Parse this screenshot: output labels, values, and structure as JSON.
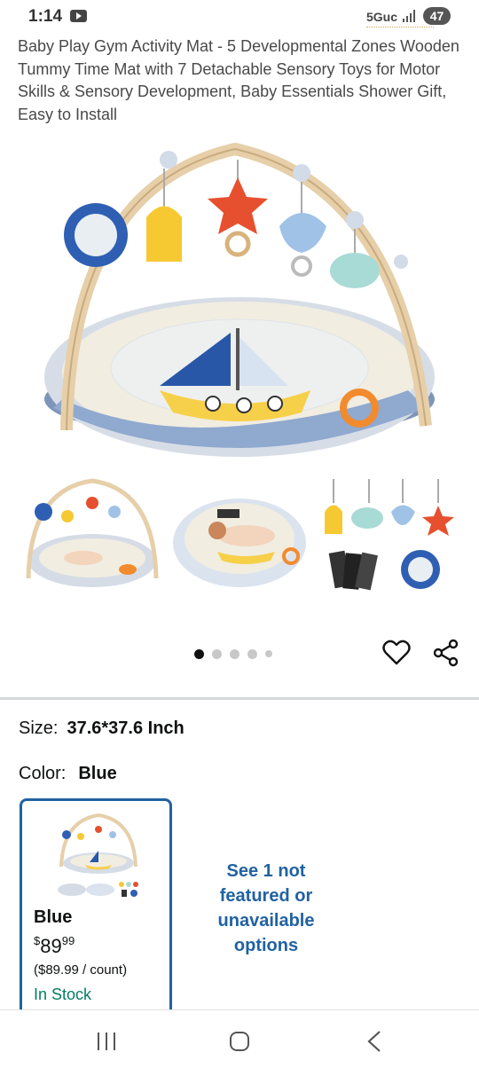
{
  "status_bar": {
    "time": "1:14",
    "network": "5Guc",
    "battery": "47"
  },
  "product": {
    "title": "Baby Play Gym Activity Mat - 5 Developmental Zones Wooden Tummy Time Mat with 7 Detachable Sensory Toys for Motor Skills & Sensory Development, Baby Essentials Shower Gift, Easy to Install"
  },
  "gallery": {
    "dot_count": 5,
    "active_index": 0
  },
  "size": {
    "label": "Size:",
    "value": "37.6*37.6 Inch"
  },
  "color": {
    "label": "Color:",
    "value": "Blue"
  },
  "option": {
    "name": "Blue",
    "price_symbol": "$",
    "price_whole": "89",
    "price_cents": "99",
    "unit_price": "($89.99 / count)",
    "stock": "In Stock"
  },
  "see_more": "See 1 not featured or unavailable options",
  "colors": {
    "accent": "#2162a1",
    "stock_green": "#067d62"
  }
}
